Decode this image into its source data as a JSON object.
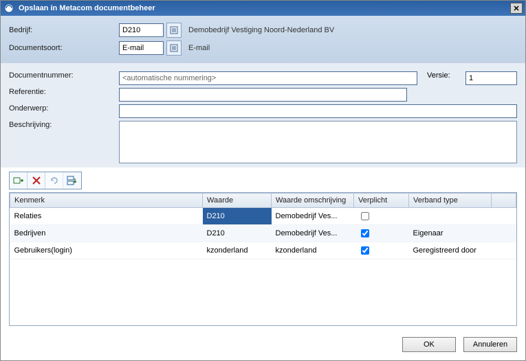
{
  "title": "Opslaan in Metacom documentbeheer",
  "top": {
    "bedrijf_label": "Bedrijf:",
    "bedrijf_value": "D210",
    "bedrijf_desc": "Demobedrijf Vestiging Noord-Nederland BV",
    "docsoort_label": "Documentsoort:",
    "docsoort_value": "E-mail",
    "docsoort_desc": "E-mail"
  },
  "mid": {
    "docnr_label": "Documentnummer:",
    "docnr_value": "<automatische nummering>",
    "versie_label": "Versie:",
    "versie_value": "1",
    "referentie_label": "Referentie:",
    "referentie_value": "",
    "onderwerp_label": "Onderwerp:",
    "onderwerp_value": "",
    "beschrijving_label": "Beschrijving:",
    "beschrijving_value": ""
  },
  "grid": {
    "headers": {
      "kenmerk": "Kenmerk",
      "waarde": "Waarde",
      "omschrijving": "Waarde omschrijving",
      "verplicht": "Verplicht",
      "verband": "Verband type"
    },
    "rows": [
      {
        "kenmerk": "Relaties",
        "waarde": "D210",
        "omschrijving": "Demobedrijf Ves...",
        "verplicht": false,
        "verband": "",
        "selected": true
      },
      {
        "kenmerk": "Bedrijven",
        "waarde": "D210",
        "omschrijving": "Demobedrijf Ves...",
        "verplicht": true,
        "verband": "Eigenaar",
        "selected": false
      },
      {
        "kenmerk": "Gebruikers(login)",
        "waarde": "kzonderland",
        "omschrijving": "kzonderland",
        "verplicht": true,
        "verband": "Geregistreerd door",
        "selected": false
      }
    ]
  },
  "buttons": {
    "ok": "OK",
    "cancel": "Annuleren"
  }
}
